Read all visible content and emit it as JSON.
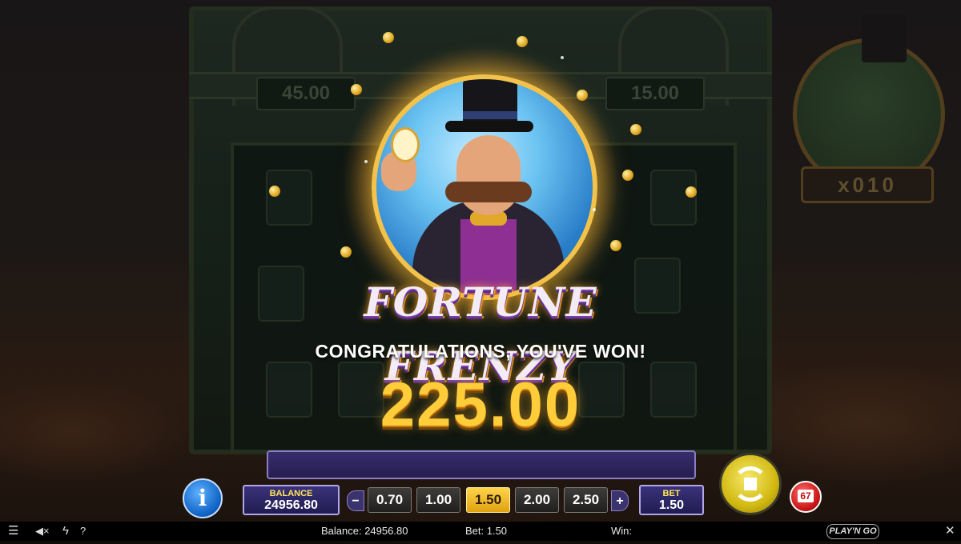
{
  "game": {
    "feature_title": "FORTUNE FRENZY",
    "congrats_text": "CONGRATULATIONS, YOU'VE WON!",
    "win_amount": "225.00",
    "meter_left": "45.00",
    "meter_right": "15.00",
    "multiplier_badge": "x010"
  },
  "controls": {
    "info_label": "i",
    "balance_label": "BALANCE",
    "balance_value": "24956.80",
    "bet_decrease": "−",
    "bet_increase": "+",
    "bet_options": [
      "0.70",
      "1.00",
      "1.50",
      "2.00",
      "2.50"
    ],
    "selected_bet": "1.50",
    "bet_label": "BET",
    "bet_value": "1.50",
    "autoplay_count": "67"
  },
  "footer": {
    "balance_text": "Balance: 24956.80",
    "bet_text": "Bet: 1.50",
    "win_text": "Win:",
    "menu_icon": "☰",
    "sound_icon": "◀×",
    "turbo_icon": "ϟ",
    "help_icon": "?",
    "logo_text": "PLAY'N GO",
    "close_icon": "✕"
  },
  "colors": {
    "accent_gold": "#ffcc3a",
    "panel_purple": "#2d2566",
    "selected_bet": "#f2bd28",
    "info_blue": "#1266c8",
    "autoplay_red": "#c91515"
  }
}
